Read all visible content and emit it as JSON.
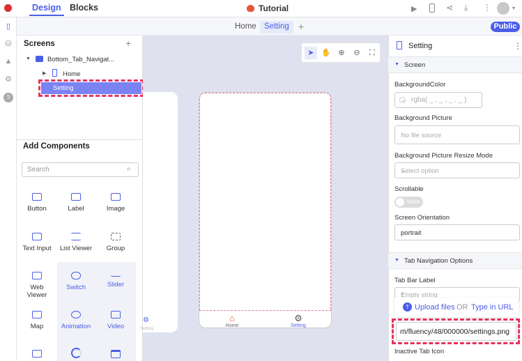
{
  "topbar": {
    "tabs": [
      "Design",
      "Blocks"
    ],
    "project_title": "Tutorial"
  },
  "subbar": {
    "screen_tabs": [
      "Home",
      "Setting"
    ],
    "add_symbol": "+",
    "public_label": "Public"
  },
  "screens_panel": {
    "title": "Screens",
    "add_symbol": "+",
    "root": "Bottom_Tab_Navigat...",
    "items": [
      "Home",
      "Setting"
    ]
  },
  "components_panel": {
    "title": "Add Components",
    "search_placeholder": "Search",
    "items": [
      "Button",
      "Label",
      "Image",
      "Text Input",
      "List Viewer",
      "Group",
      "Web Viewer",
      "Switch",
      "Slider",
      "Map",
      "Animation",
      "Video"
    ]
  },
  "canvas": {
    "left_phone_tab_label": "Setting",
    "nav": [
      "Home",
      "Setting"
    ]
  },
  "props": {
    "title": "Setting",
    "screen_section": "Screen",
    "bg_color_label": "BackgroundColor",
    "bg_color_value": "rgba( _ , _ , _ , _ )",
    "bg_picture_label": "Background Picture",
    "bg_picture_placeholder": "No file source",
    "resize_label": "Background Picture Resize Mode",
    "resize_placeholder": "Select option",
    "scrollable_label": "Scrollable",
    "scrollable_value": "false",
    "orientation_label": "Screen Orientation",
    "orientation_value": "portrait",
    "tab_section": "Tab Navigation Options",
    "tab_bar_label": "Tab Bar Label",
    "tab_bar_placeholder": "Empty string",
    "upload_label": "Upload files",
    "or_label": "OR",
    "type_url_label": "Type in URL",
    "url_value": "m/fluency/48/000000/settings.png",
    "clear_symbol": "×",
    "inactive_icon_label": "Inactive Tab Icon"
  },
  "colors": {
    "accent": "#4b5ee8",
    "highlight_dash": "#e5335f",
    "canvas_bg": "#dfe2ee"
  }
}
